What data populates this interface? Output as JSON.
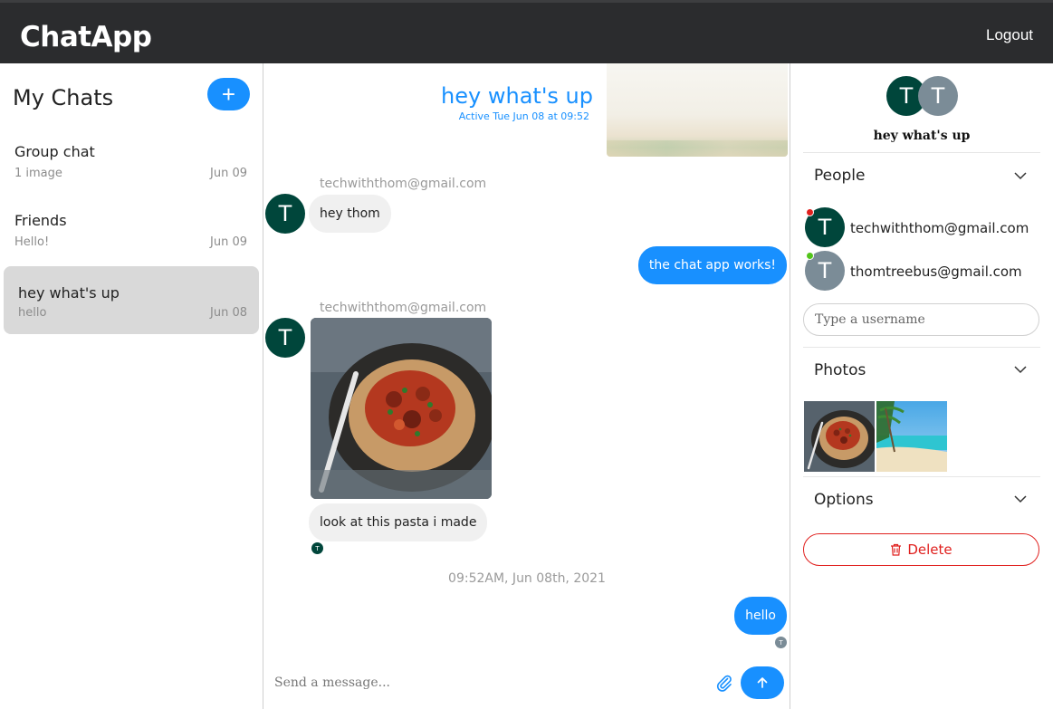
{
  "app": {
    "brand": "ChatApp",
    "logout_label": "Logout"
  },
  "chat_list": {
    "title": "My Chats",
    "new_chat_label": "+",
    "items": [
      {
        "name": "Group chat",
        "preview": "1 image",
        "date": "Jun 09"
      },
      {
        "name": "Friends",
        "preview": "Hello!",
        "date": "Jun 09"
      },
      {
        "name": "hey what's up",
        "preview": "hello",
        "date": "Jun 08"
      }
    ]
  },
  "feed": {
    "title": "hey what's up",
    "subtitle": "Active Tue Jun 08 at 09:52",
    "messages": [
      {
        "sender": "techwiththom@gmail.com",
        "avatar_initial": "T",
        "text": "hey thom"
      },
      {
        "text": "the chat app works!"
      },
      {
        "sender": "techwiththom@gmail.com",
        "avatar_initial": "T",
        "text": "look at this pasta i made",
        "read_initial": "T"
      },
      {
        "text": "hello",
        "read_initial": "T"
      }
    ],
    "timestamp": "09:52AM, Jun 08th, 2021",
    "composer_placeholder": "Send a message..."
  },
  "settings": {
    "title": "hey what's up",
    "avatar_initials": [
      "T",
      "T"
    ],
    "people_label": "People",
    "people": [
      {
        "initial": "T",
        "email": "techwiththom@gmail.com",
        "status_color": "#e0201e"
      },
      {
        "initial": "T",
        "email": "thomtreebus@gmail.com",
        "status_color": "#52c41a"
      }
    ],
    "username_placeholder": "Type a username",
    "photos_label": "Photos",
    "options_label": "Options",
    "delete_label": "Delete"
  },
  "colors": {
    "accent": "#1890ff",
    "topbar": "#2b2c2e",
    "avatar_dark": "#00463b",
    "avatar_gray": "#7b8c97",
    "danger": "#e0201e"
  }
}
